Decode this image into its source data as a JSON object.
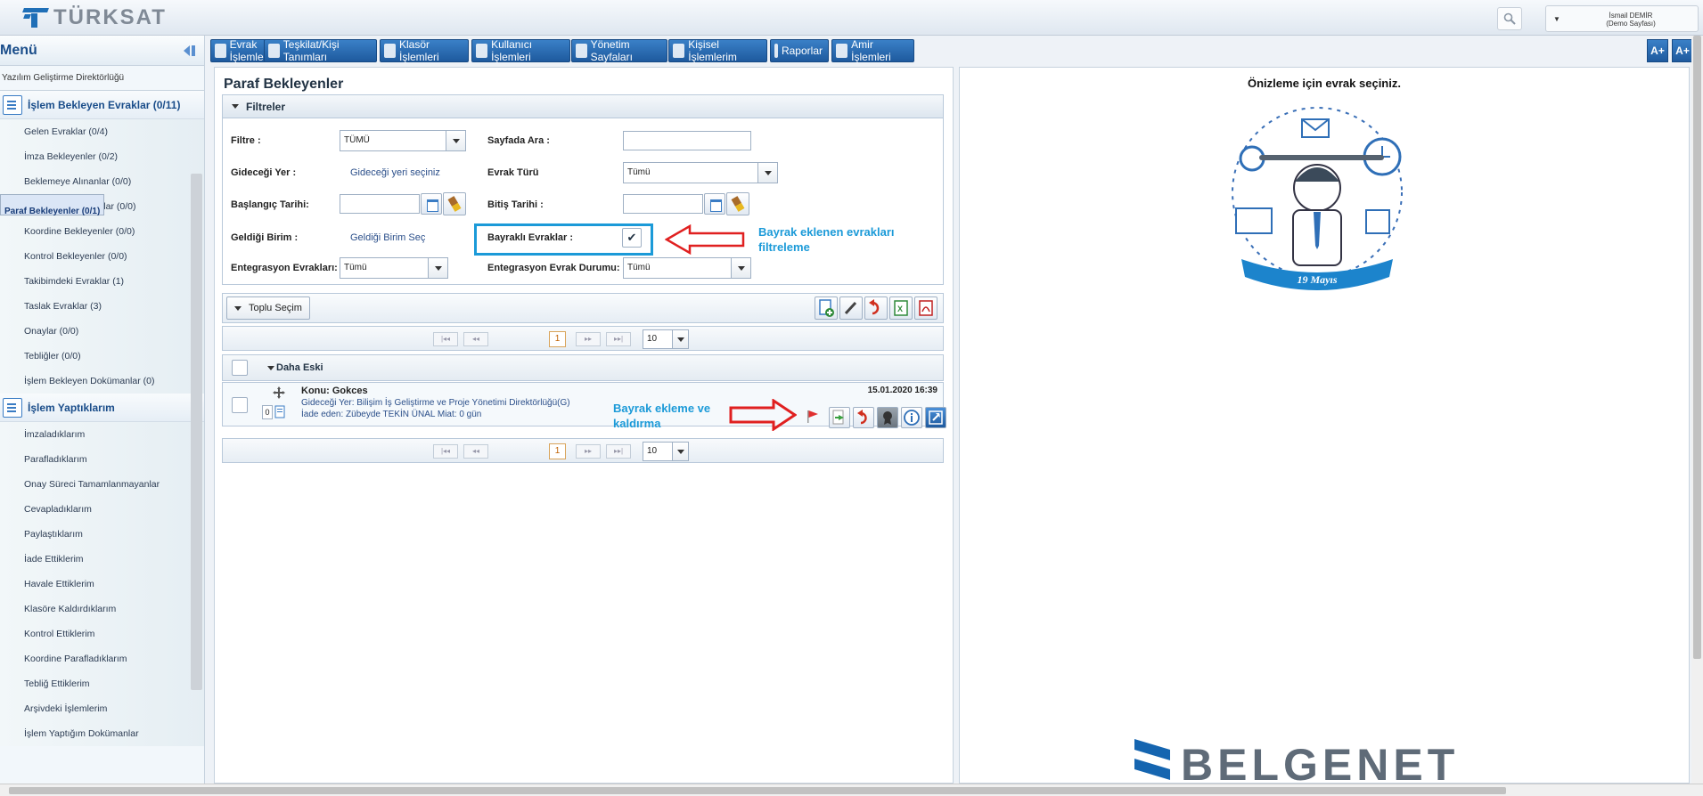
{
  "header": {
    "brand": "TÜRKSAT",
    "user_name": "İsmail DEMİR",
    "user_role": "(Demo Sayfası)"
  },
  "sidebar": {
    "title": "Menü",
    "department": "Yazılım Geliştirme Direktörlüğü",
    "section1": {
      "title": "İşlem Bekleyen Evraklar (0/11)",
      "items": [
        {
          "label": "Gelen Evraklar (0/4)"
        },
        {
          "label": "İmza Bekleyenler (0/2)"
        },
        {
          "label": "Beklemeye Alınanlar (0/0)"
        },
        {
          "label": "Paraf Bekleyenler (0/1)",
          "selected": true
        },
        {
          "label": "Benimle Paylaşılanlar (0/0)"
        },
        {
          "label": "Koordine Bekleyenler (0/0)"
        },
        {
          "label": "Kontrol Bekleyenler (0/0)"
        },
        {
          "label": "Takibimdeki Evraklar (1)"
        },
        {
          "label": "Taslak Evraklar (3)"
        },
        {
          "label": "Onaylar (0/0)"
        },
        {
          "label": "Tebliğler (0/0)"
        },
        {
          "label": "İşlem Bekleyen Dokümanlar (0)"
        }
      ]
    },
    "section2": {
      "title": "İşlem Yaptıklarım",
      "items": [
        {
          "label": "İmzaladıklarım"
        },
        {
          "label": "Parafladıklarım"
        },
        {
          "label": "Onay Süreci Tamamlanmayanlar"
        },
        {
          "label": "Cevapladıklarım"
        },
        {
          "label": "Paylaştıklarım"
        },
        {
          "label": "İade Ettiklerim"
        },
        {
          "label": "Havale Ettiklerim"
        },
        {
          "label": "Klasöre Kaldırdıklarım"
        },
        {
          "label": "Kontrol Ettiklerim"
        },
        {
          "label": "Koordine Parafladıklarım"
        },
        {
          "label": "Tebliğ Ettiklerim"
        },
        {
          "label": "Arşivdeki İşlemlerim"
        },
        {
          "label": "İşlem Yaptığım Dokümanlar"
        }
      ]
    }
  },
  "menubar": {
    "tabs": [
      {
        "label": "Evrak İşlemleri"
      },
      {
        "label": "Teşkilat/Kişi Tanımları"
      },
      {
        "label": "Klasör İşlemleri"
      },
      {
        "label": "Kullanıcı İşlemleri"
      },
      {
        "label": "Yönetim Sayfaları"
      },
      {
        "label": "Kişisel İşlemlerim"
      },
      {
        "label": "Raporlar"
      },
      {
        "label": "Amir İşlemleri"
      }
    ],
    "font_increase": "A+",
    "font_increase2": "A+"
  },
  "main": {
    "title": "Paraf Bekleyenler",
    "filters": {
      "header": "Filtreler",
      "filtre_label": "Filtre :",
      "filtre_value": "TÜMÜ",
      "sayfada_ara_label": "Sayfada Ara :",
      "sayfada_ara_value": "",
      "gidecegi_yer_label": "Gideceği Yer :",
      "gidecegi_yer_value": "Gideceği yeri seçiniz",
      "evrak_turu_label": "Evrak Türü",
      "evrak_turu_value": "Tümü",
      "baslangic_label": "Başlangıç Tarihi:",
      "baslangic_value": "",
      "bitis_label": "Bitiş Tarihi :",
      "bitis_value": "",
      "geldigi_birim_label": "Geldiği Birim :",
      "geldigi_birim_value": "Geldiği Birim Seç",
      "bayrakli_label": "Bayraklı Evraklar :",
      "bayrakli_checked": true,
      "entegrasyon_label": "Entegrasyon Evrakları:",
      "entegrasyon_value": "Tümü",
      "entegrasyon_durum_label": "Entegrasyon Evrak Durumu:",
      "entegrasyon_durum_value": "Tümü"
    },
    "annotation_filter": {
      "line1": "Bayrak eklenen evrakları",
      "line2": "filtreleme"
    },
    "toolbar": {
      "toplu_secim": "Toplu Seçim"
    },
    "pager": {
      "first": "|◂◂",
      "prev": "◂◂",
      "page": "1",
      "next": "▸▸",
      "last": "▸▸|",
      "page_size": "10"
    },
    "group": {
      "label": "Daha Eski"
    },
    "document": {
      "count": "0",
      "subject": "Konu: Gokces",
      "date": "15.01.2020 16:39",
      "destination": "Gideceği Yer: Bilişim İş Geliştirme ve Proje Yönetimi Direktörlüğü(G)",
      "returned_by": "İade eden: Zübeyde TEKİN ÜNAL Miat: 0 gün"
    },
    "annotation_flag": {
      "line1": "Bayrak ekleme ve",
      "line2": "kaldırma"
    }
  },
  "preview": {
    "title": "Önizleme için evrak seçiniz.",
    "ribbon_text": "19 Mayıs",
    "watermark": "BELGENET"
  },
  "colors": {
    "accent": "#1e5a9e",
    "annotation_blue": "#1b9ad8",
    "annotation_red": "#e02020"
  }
}
